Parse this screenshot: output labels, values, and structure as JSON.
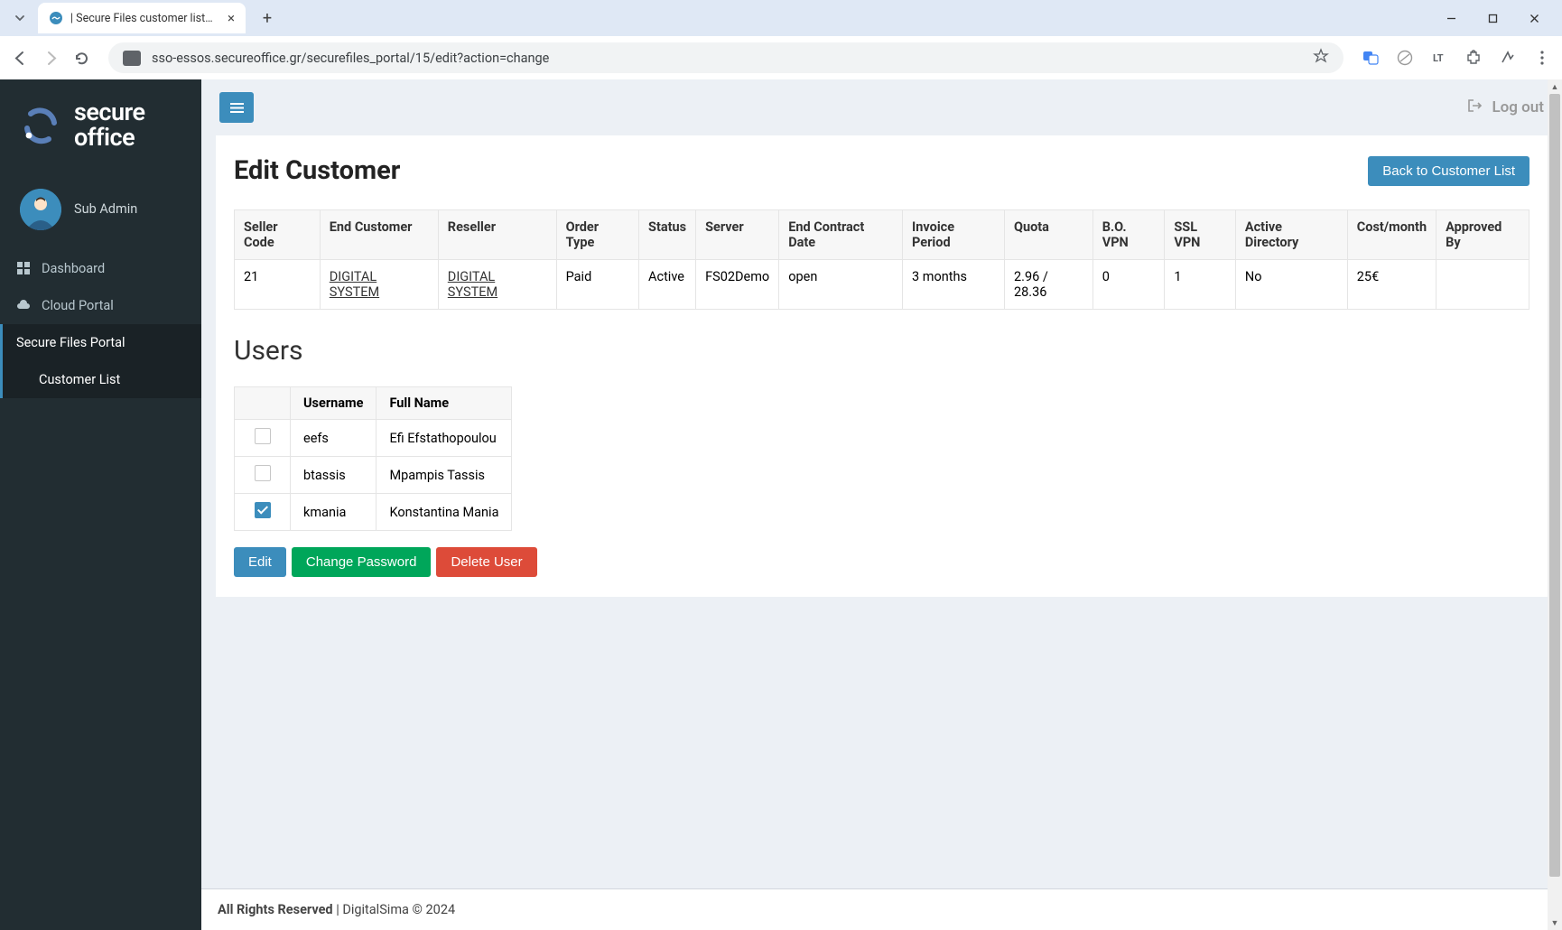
{
  "browser": {
    "tab_title": "| Secure Files customer list edit",
    "url": "sso-essos.secureoffice.gr/securefiles_portal/15/edit?action=change"
  },
  "brand": {
    "name_line1": "secure",
    "name_line2": "office"
  },
  "user": {
    "role": "Sub Admin"
  },
  "sidebar": {
    "items": [
      {
        "icon": "grid",
        "label": "Dashboard",
        "active": false
      },
      {
        "icon": "cloud",
        "label": "Cloud Portal",
        "active": false
      },
      {
        "icon": "",
        "label": "Secure Files Portal",
        "active": true
      },
      {
        "icon": "",
        "label": "Customer List",
        "active": true,
        "sub": true
      }
    ]
  },
  "topbar": {
    "logout_label": "Log out"
  },
  "page": {
    "title": "Edit Customer",
    "back_button": "Back to Customer List"
  },
  "details_table": {
    "headers": [
      "Seller Code",
      "End Customer",
      "Reseller",
      "Order Type",
      "Status",
      "Server",
      "End Contract Date",
      "Invoice Period",
      "Quota",
      "B.O. VPN",
      "SSL VPN",
      "Active Directory",
      "Cost/month",
      "Approved By"
    ],
    "row": {
      "seller_code": "21",
      "end_customer": "DIGITAL SYSTEM",
      "reseller": "DIGITAL SYSTEM",
      "order_type": "Paid",
      "status": "Active",
      "server": "FS02Demo",
      "end_contract_date": "open",
      "invoice_period": "3 months",
      "quota": "2.96 / 28.36",
      "bo_vpn": "0",
      "ssl_vpn": "1",
      "active_directory": "No",
      "cost_month": "25€",
      "approved_by": ""
    }
  },
  "users_section": {
    "title": "Users",
    "headers": {
      "username": "Username",
      "full_name": "Full Name"
    },
    "rows": [
      {
        "checked": false,
        "username": "eefs",
        "full_name": "Efi Efstathopoulou"
      },
      {
        "checked": false,
        "username": "btassis",
        "full_name": "Mpampis Tassis"
      },
      {
        "checked": true,
        "username": "kmania",
        "full_name": "Konstantina Mania"
      }
    ],
    "actions": {
      "edit": "Edit",
      "change_password": "Change Password",
      "delete": "Delete User"
    }
  },
  "footer": {
    "bold": "All Rights Reserved",
    "rest": " | DigitalSima © 2024"
  },
  "colors": {
    "accent": "#3c8dbc",
    "success": "#00a65a",
    "danger": "#dd4b39",
    "sidebar_bg": "#222d32"
  }
}
